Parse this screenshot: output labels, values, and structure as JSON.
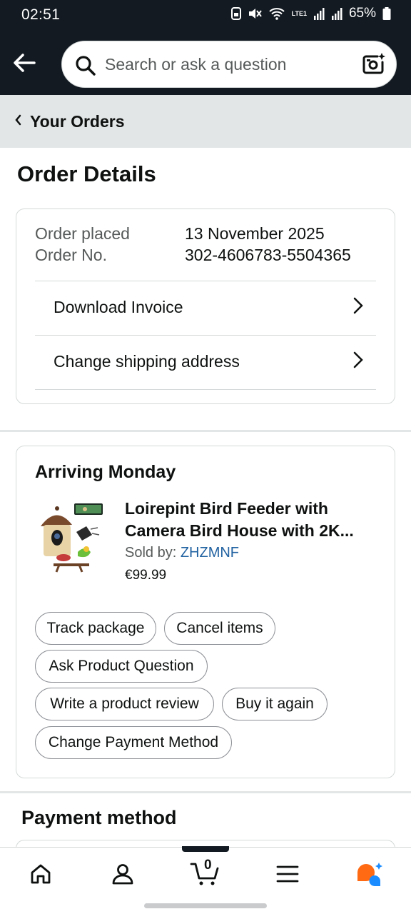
{
  "status_bar": {
    "time": "02:51",
    "battery": "65%",
    "network_label": "LTE1",
    "icons": [
      "vpn-lock-icon",
      "mute-icon",
      "wifi-icon",
      "lte-icon",
      "signal-icon",
      "signal-icon",
      "battery-icon"
    ]
  },
  "header": {
    "search_placeholder": "Search or ask a question",
    "icons": [
      "back-arrow-icon",
      "search-icon",
      "camera-search-icon"
    ]
  },
  "breadcrumb": {
    "label": "Your Orders"
  },
  "page_title": "Order Details",
  "order_summary": {
    "placed_label": "Order placed",
    "placed_value": "13 November 2025",
    "number_label": "Order No.",
    "number_value": "302-4606783-5504365",
    "links": [
      {
        "label": "Download Invoice"
      },
      {
        "label": "Change shipping address"
      }
    ]
  },
  "shipment": {
    "status": "Arriving Monday",
    "product": {
      "title": "Loirepint Bird Feeder with Camera Bird House with 2K...",
      "sold_by_label": "Sold by: ",
      "seller": "ZHZMNF",
      "price": "€99.99"
    },
    "actions": [
      {
        "label": "Track package"
      },
      {
        "label": "Cancel items"
      },
      {
        "label": "Ask Product Question"
      },
      {
        "label": "Write a product review"
      },
      {
        "label": "Buy it again"
      },
      {
        "label": "Change Payment Method"
      }
    ]
  },
  "payment": {
    "title": "Payment method"
  },
  "bottom_nav": {
    "items": [
      "home-icon",
      "account-icon",
      "cart-icon",
      "menu-icon",
      "rufus-ai-icon"
    ],
    "active": "cart-icon",
    "cart_count": "0"
  },
  "colors": {
    "header_bg": "#131a22",
    "breadcrumb_bg": "#e3e6e6",
    "link": "#2162a1",
    "ai_orange": "#ff6a13",
    "ai_blue": "#1a8cff"
  }
}
